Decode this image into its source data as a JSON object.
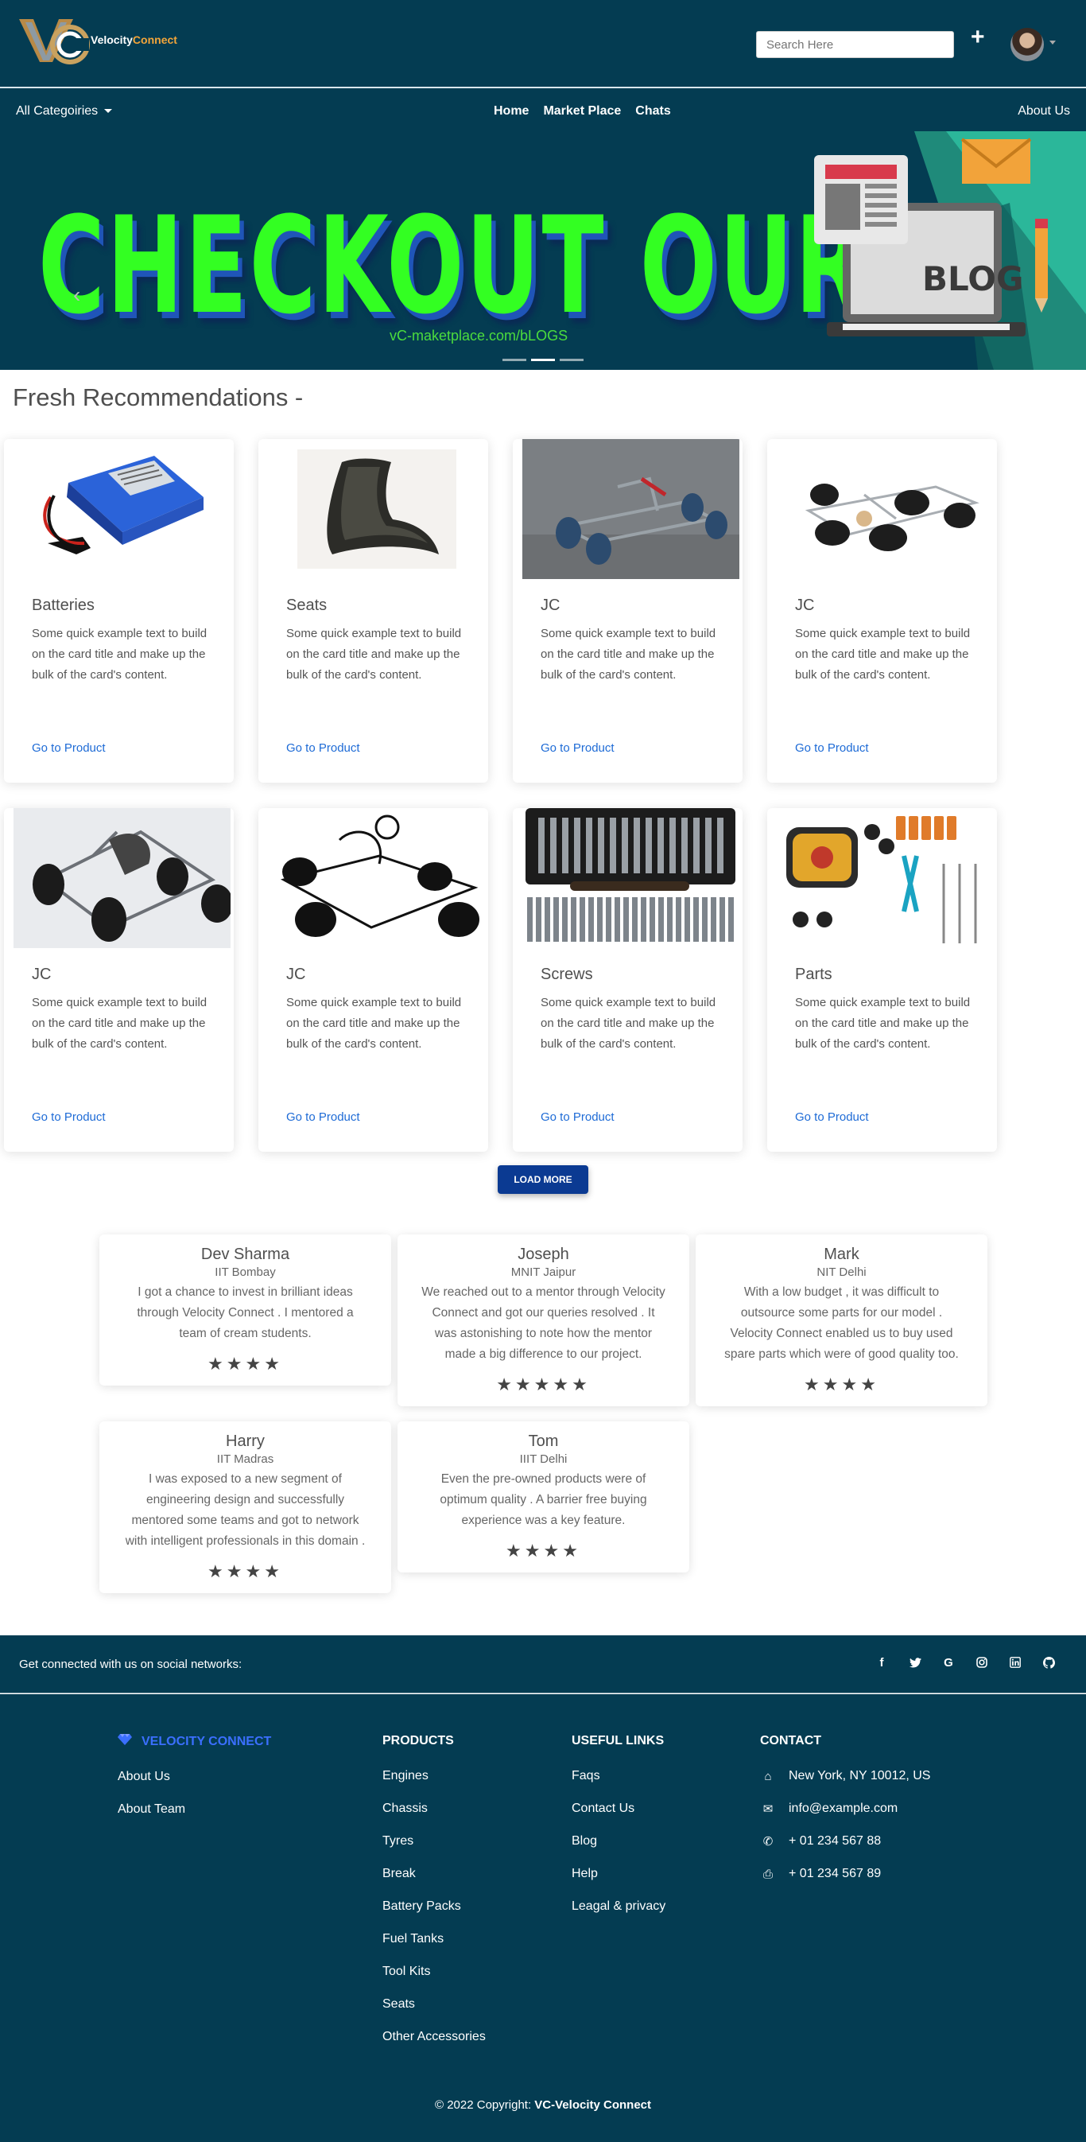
{
  "header": {
    "logo_text_prefix": "Velocity",
    "logo_text_suffix": "Connect",
    "search_placeholder": "Search Here",
    "add_icon": "plus-icon"
  },
  "nav": {
    "categories_label": "All Categoiries",
    "home": "Home",
    "marketplace": "Market Place",
    "chats": "Chats",
    "about": "About Us"
  },
  "hero": {
    "title": "CHECKOUT OUR",
    "url": "vC-maketplace.com/bLOGS",
    "blog_label": "BLOG",
    "slides": 3,
    "active_slide": 2
  },
  "recommendations": {
    "title": "Fresh Recommendations -",
    "link_label": "Go to Product",
    "load_more": "LOAD MORE",
    "products": [
      {
        "title": "Batteries",
        "text": "Some quick example text to build on the card title and make up the bulk of the card's content.",
        "image": "battery-pack"
      },
      {
        "title": "Seats",
        "text": "Some quick example text to build on the card title and make up the bulk of the card's content.",
        "image": "kart-seat"
      },
      {
        "title": "JC",
        "text": "Some quick example text to build on the card title and make up the bulk of the card's content.",
        "image": "kart-frame"
      },
      {
        "title": "JC",
        "text": "Some quick example text to build on the card title and make up the bulk of the card's content.",
        "image": "kart-chassis"
      },
      {
        "title": "JC",
        "text": "Some quick example text to build on the card title and make up the bulk of the card's content.",
        "image": "kart-render"
      },
      {
        "title": "JC",
        "text": "Some quick example text to build on the card title and make up the bulk of the card's content.",
        "image": "kart-sketch"
      },
      {
        "title": "Screws",
        "text": "Some quick example text to build on the card title and make up the bulk of the card's content.",
        "image": "screwdriver-kit"
      },
      {
        "title": "Parts",
        "text": "Some quick example text to build on the card title and make up the bulk of the card's content.",
        "image": "tool-parts"
      }
    ]
  },
  "testimonials": [
    {
      "name": "Dev Sharma",
      "school": "IIT Bombay",
      "quote": "I got a chance to invest in brilliant ideas through Velocity Connect . I mentored a team of cream students.",
      "stars": 4
    },
    {
      "name": "Joseph",
      "school": "MNIT Jaipur",
      "quote": "We reached out to a mentor through Velocity Connect and got our queries resolved . It was astonishing to note how the mentor made a big difference to our project.",
      "stars": 5
    },
    {
      "name": "Mark",
      "school": "NIT Delhi",
      "quote": "With a low budget , it was difficult to outsource some parts for our model . Velocity Connect enabled us to buy used spare parts which were of good quality too.",
      "stars": 4
    },
    {
      "name": "Harry",
      "school": "IIT Madras",
      "quote": "I was exposed to a new segment of engineering design and successfully mentored some teams and got to network with intelligent professionals in this domain .",
      "stars": 4
    },
    {
      "name": "Tom",
      "school": "IIIT Delhi",
      "quote": "Even the pre-owned products were of optimum quality . A barrier free buying experience was a key feature.",
      "stars": 4
    }
  ],
  "social": {
    "text": "Get connected with us on social networks:",
    "icons": [
      "facebook-icon",
      "twitter-icon",
      "google-icon",
      "instagram-icon",
      "linkedin-icon",
      "github-icon"
    ]
  },
  "footer": {
    "brand": "VELOCITY CONNECT",
    "brand_links": [
      "About Us",
      "About Team"
    ],
    "products_title": "PRODUCTS",
    "products": [
      "Engines",
      "Chassis",
      "Tyres",
      "Break",
      "Battery Packs",
      "Fuel Tanks",
      "Tool Kits",
      "Seats",
      "Other Accessories"
    ],
    "useful_title": "USEFUL LINKS",
    "useful": [
      "Faqs",
      "Contact Us",
      "Blog",
      "Help",
      "Leagal & privacy"
    ],
    "contact_title": "CONTACT",
    "contact": [
      {
        "icon": "home-icon",
        "text": "New York, NY 10012, US"
      },
      {
        "icon": "envelope-icon",
        "text": "info@example.com"
      },
      {
        "icon": "phone-icon",
        "text": "+ 01 234 567 88"
      },
      {
        "icon": "print-icon",
        "text": "+ 01 234 567 89"
      }
    ],
    "copyright_prefix": "© 2022 Copyright:",
    "copyright_brand": "VC-Velocity Connect"
  },
  "colors": {
    "navy": "#043c52",
    "link": "#1e6bd6",
    "hero_green": "#33ff22",
    "button": "#0b3a92"
  }
}
